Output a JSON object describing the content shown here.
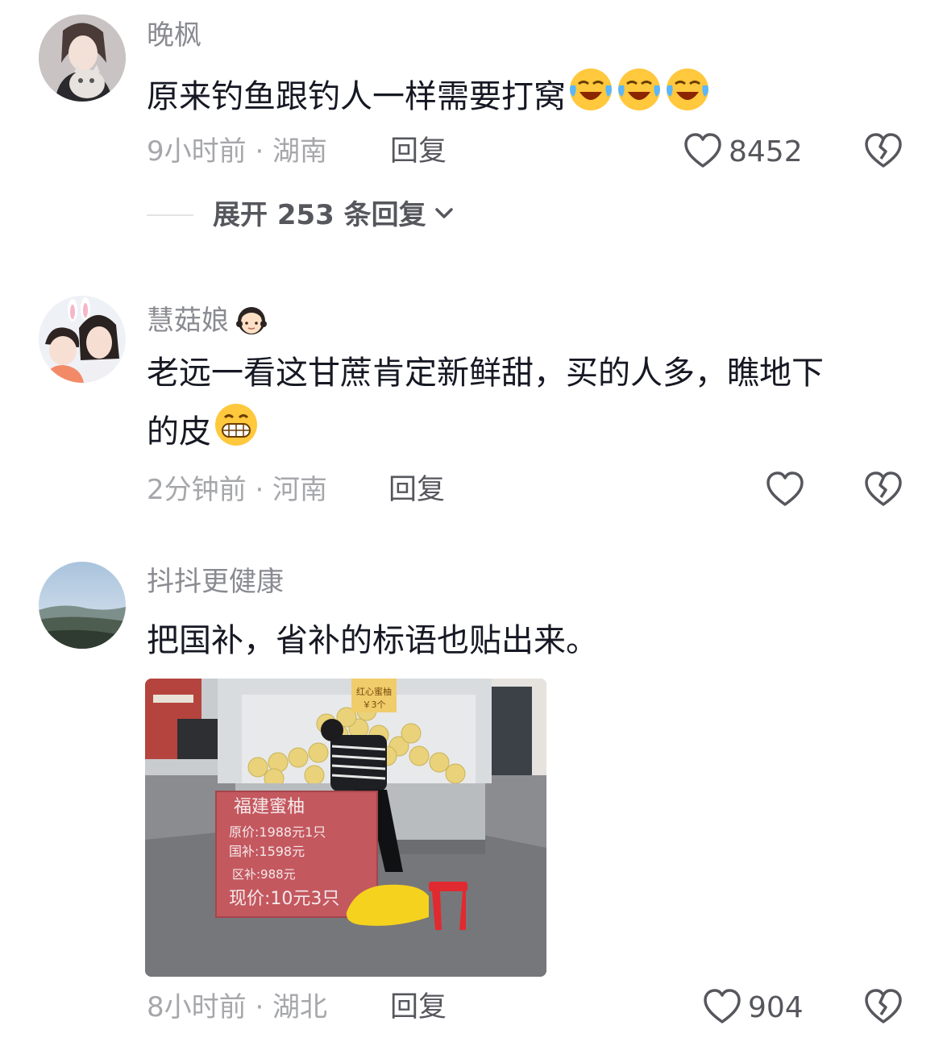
{
  "comments": [
    {
      "username": "晚枫",
      "text": "原来钓鱼跟钓人一样需要打窝",
      "emoji": [
        "crying-laughing-emoji",
        "crying-laughing-emoji",
        "crying-laughing-emoji"
      ],
      "meta": "9小时前 · 湖南",
      "reply_label": "回复",
      "likes": "8452",
      "expand_replies": "展开 253 条回复"
    },
    {
      "username": "慧菇娘",
      "username_emoji": "girl-emoji",
      "text_line1": "老远一看这甘蔗肯定新鲜甜，买的人多，瞧地下",
      "text_line2": "的皮",
      "emoji": [
        "grinning-teeth-emoji"
      ],
      "meta": "2分钟前 · 河南",
      "reply_label": "回复",
      "likes": ""
    },
    {
      "username": "抖抖更健康",
      "text": "把国补，省补的标语也贴出来。",
      "image": {
        "sign_title": "福建蜜柚",
        "sign_line1": "原价:1988元1只",
        "sign_line2": "国补:1598元",
        "sign_line3": "区补:988元",
        "sign_line4": "现价:10元3只",
        "top_sign": "红心蜜柚 ￥3个"
      },
      "meta": "8小时前 · 湖北",
      "reply_label": "回复",
      "likes": "904"
    }
  ],
  "colors": {
    "text_primary": "#161823",
    "text_secondary": "#8a8b91",
    "text_meta": "#a6a7ab",
    "accent_grey": "#56575d"
  }
}
